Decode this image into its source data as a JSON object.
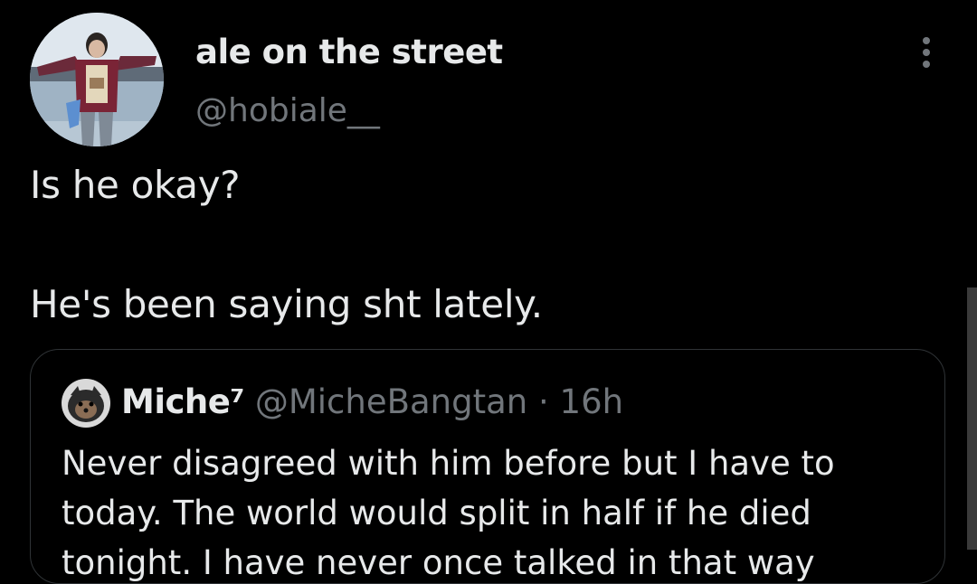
{
  "tweet": {
    "display_name": "ale on the street",
    "handle": "@hobiale__",
    "text_line1": "Is he okay?",
    "text_line2": "He's been saying sht lately."
  },
  "quoted_tweet": {
    "name": "Miche⁷",
    "handle": "@MicheBangtan",
    "separator": "·",
    "time": "16h",
    "text": "Never disagreed with him before but I have to today. The world would split in half if he died tonight. I have never once talked in that way"
  },
  "icons": {
    "more": "more-options-icon"
  },
  "colors": {
    "background": "#000000",
    "primary_text": "#e7e9ea",
    "secondary_text": "#71767b",
    "border": "#2f3336"
  }
}
